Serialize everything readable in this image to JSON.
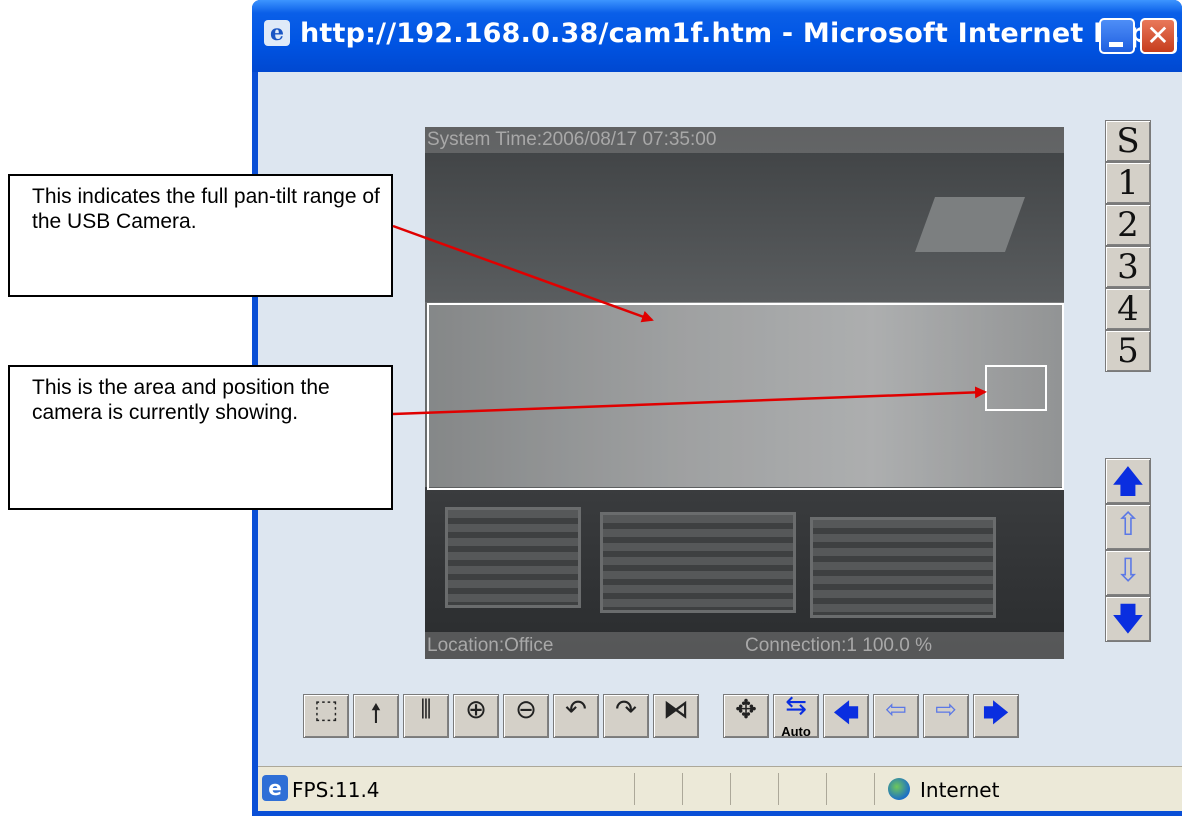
{
  "window": {
    "title": "http://192.168.0.38/cam1f.htm - Microsoft Internet Exp...",
    "title_icon": "e",
    "minimize_icon": "minimize-icon",
    "maximize_icon": "maximize-icon",
    "close_glyph": "✕"
  },
  "video": {
    "system_time": "System Time:2006/08/17 07:35:00",
    "location": "Location:Office",
    "connection": "Connection:1  100.0 %"
  },
  "presets": [
    "S",
    "1",
    "2",
    "3",
    "4",
    "5"
  ],
  "tilt_controls": [
    {
      "icon": "up-arrow-solid-icon",
      "glyph": "🡅"
    },
    {
      "icon": "up-arrow-outline-icon",
      "glyph": "⇧"
    },
    {
      "icon": "down-arrow-outline-icon",
      "glyph": "⇩"
    },
    {
      "icon": "down-arrow-solid-icon",
      "glyph": "🡇"
    }
  ],
  "toolbar": [
    {
      "icon": "select-area-icon",
      "glyph": "⬚"
    },
    {
      "icon": "single-figure-icon",
      "glyph": "🠕"
    },
    {
      "icon": "group-figures-icon",
      "glyph": "⫴"
    },
    {
      "icon": "zoom-in-icon",
      "glyph": "⊕"
    },
    {
      "icon": "zoom-out-icon",
      "glyph": "⊖"
    },
    {
      "icon": "rotate-left-icon",
      "glyph": "↶"
    },
    {
      "icon": "rotate-right-icon",
      "glyph": "↷"
    },
    {
      "icon": "flip-icon",
      "glyph": "⧑"
    },
    {
      "icon": "move-icon",
      "glyph": "✥"
    },
    {
      "icon": "auto-pan-icon",
      "glyph": "⇆",
      "label": "Auto"
    },
    {
      "icon": "left-arrow-solid-icon",
      "glyph": "🡄"
    },
    {
      "icon": "left-arrow-outline-icon",
      "glyph": "⇦"
    },
    {
      "icon": "right-arrow-outline-icon",
      "glyph": "⇨"
    },
    {
      "icon": "right-arrow-solid-icon",
      "glyph": "🡆"
    }
  ],
  "statusbar": {
    "fps": "FPS:11.4",
    "zone": "Internet"
  },
  "callouts": {
    "range": "This indicates the full pan-tilt range of the USB Camera.",
    "position": "This is the area and position the camera is currently showing."
  },
  "colors": {
    "titlebar": "#0054e3",
    "client": "#dde6f0",
    "arrow": "#e00000",
    "blue_arrow": "#0a2ee0"
  }
}
